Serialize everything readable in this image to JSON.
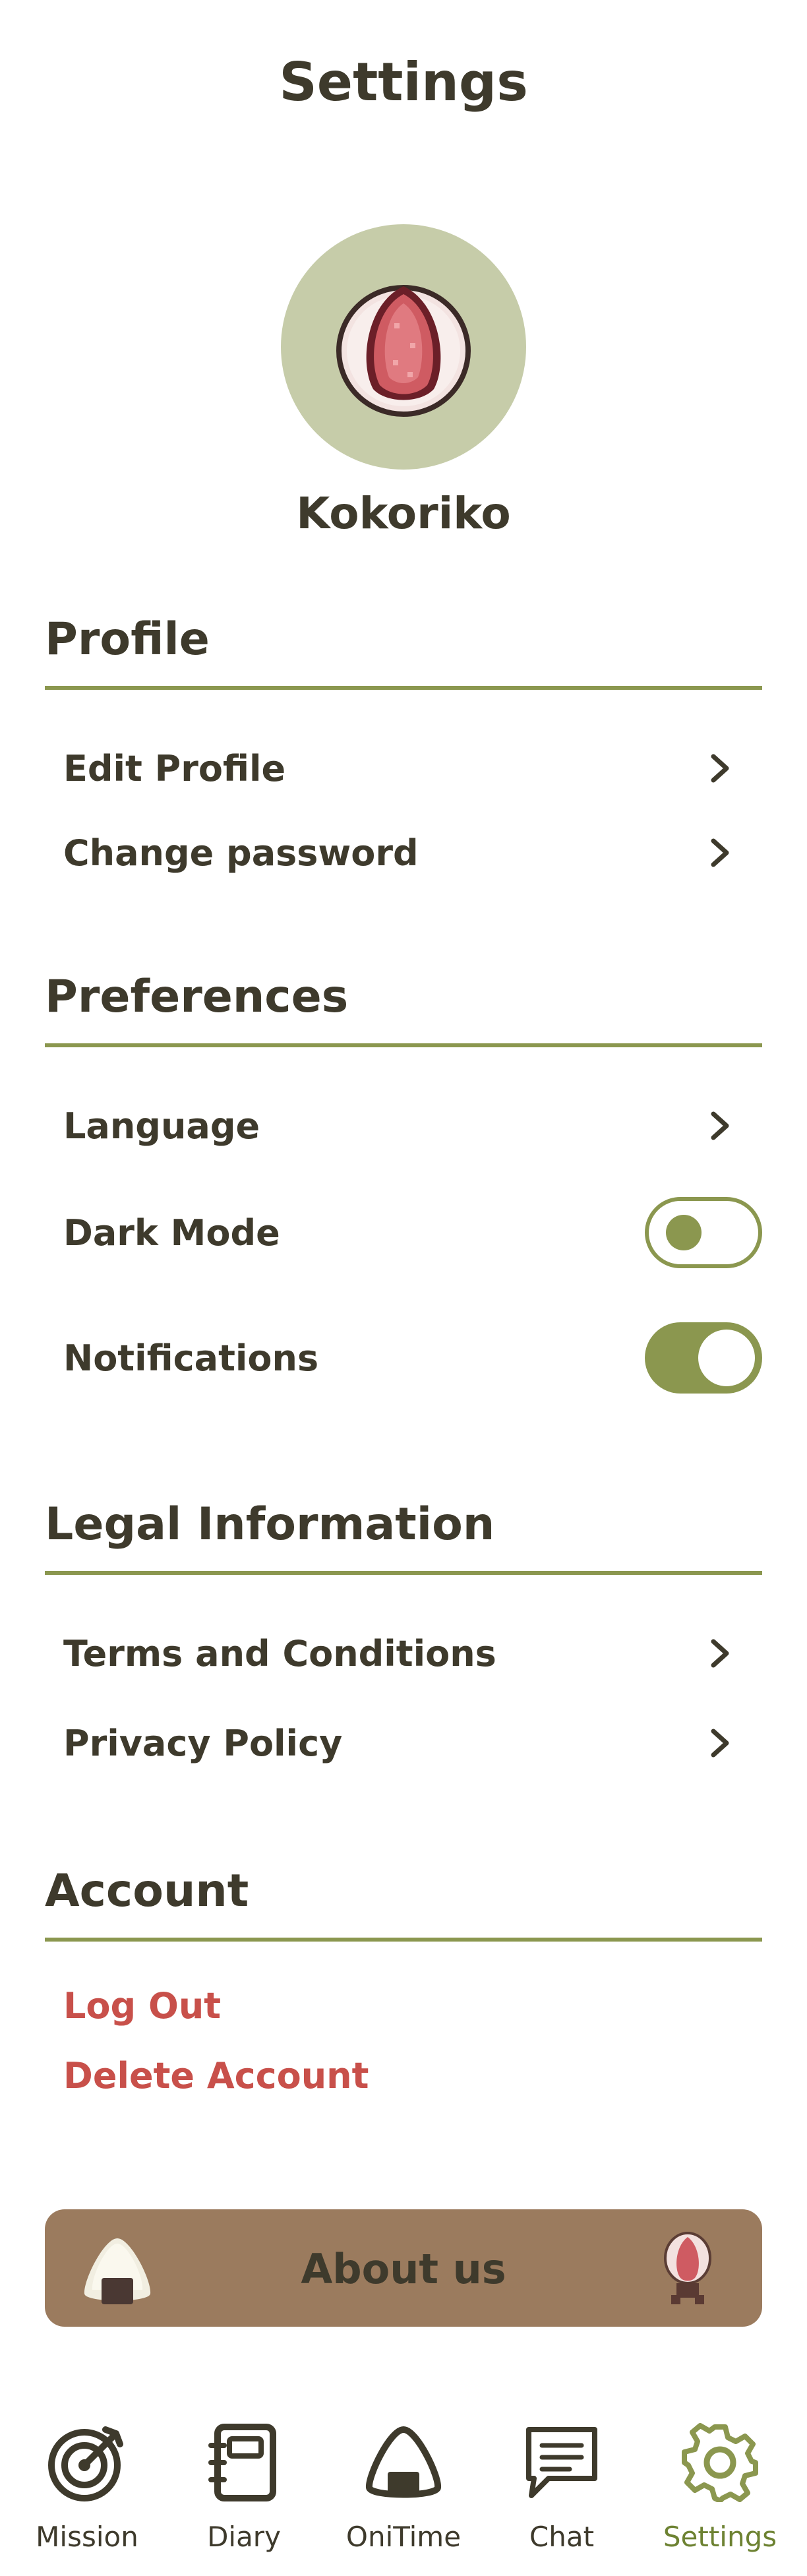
{
  "header": {
    "title": "Settings"
  },
  "profile_card": {
    "username": "Kokoriko",
    "avatar": "strawberry-daifuku-avatar"
  },
  "sections": {
    "profile": {
      "title": "Profile",
      "items": [
        {
          "label": "Edit Profile",
          "control": "chevron"
        },
        {
          "label": "Change password",
          "control": "chevron"
        }
      ]
    },
    "preferences": {
      "title": "Preferences",
      "items": [
        {
          "label": "Language",
          "control": "chevron"
        },
        {
          "label": "Dark Mode",
          "control": "toggle",
          "state": "off"
        },
        {
          "label": "Notifications",
          "control": "toggle",
          "state": "on"
        }
      ]
    },
    "legal": {
      "title": "Legal Information",
      "items": [
        {
          "label": "Terms and Conditions",
          "control": "chevron"
        },
        {
          "label": "Privacy Policy",
          "control": "chevron"
        }
      ]
    },
    "account": {
      "title": "Account",
      "items": [
        {
          "label": "Log Out"
        },
        {
          "label": "Delete Account"
        }
      ]
    }
  },
  "about": {
    "label": "About us",
    "left_icon": "onigiri-icon",
    "right_icon": "strawberry-mochi-icon"
  },
  "nav": {
    "items": [
      {
        "label": "Mission",
        "icon": "target-icon",
        "active": false
      },
      {
        "label": "Diary",
        "icon": "notebook-icon",
        "active": false
      },
      {
        "label": "OniTime",
        "icon": "onigiri-icon",
        "active": false
      },
      {
        "label": "Chat",
        "icon": "chat-bubble-icon",
        "active": false
      },
      {
        "label": "Settings",
        "icon": "gear-icon",
        "active": true
      }
    ]
  },
  "colors": {
    "accent": "#8b974f",
    "text": "#3e3a2c",
    "danger": "#c8504a",
    "about_bg": "#9b7b5e",
    "avatar_bg": "#c6cca9",
    "nav_active": "#6d8232"
  }
}
